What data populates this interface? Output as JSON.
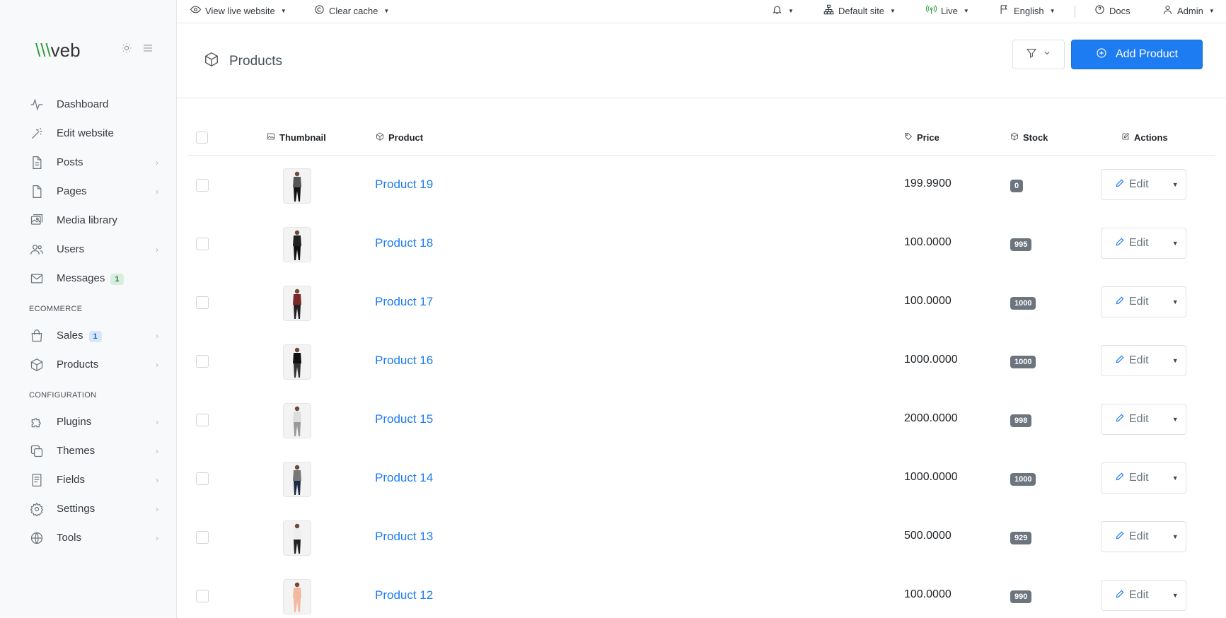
{
  "sidebar": {
    "logo": {
      "part1": "\\\\\\",
      "part2": "veb",
      "text": "\\\\\\veb"
    },
    "items": [
      {
        "label": "Dashboard",
        "icon": "activity-icon"
      },
      {
        "label": "Edit website",
        "icon": "magic-wand-icon"
      },
      {
        "label": "Posts",
        "icon": "document-icon"
      },
      {
        "label": "Pages",
        "icon": "page-icon"
      },
      {
        "label": "Media library",
        "icon": "images-icon"
      },
      {
        "label": "Users",
        "icon": "users-icon"
      },
      {
        "label": "Messages",
        "icon": "mail-icon",
        "badge": "1"
      }
    ],
    "section_ecommerce": "ECOMMERCE",
    "ecommerce_items": [
      {
        "label": "Sales",
        "icon": "shopping-bag-icon",
        "badge": "1"
      },
      {
        "label": "Products",
        "icon": "box-icon"
      }
    ],
    "section_configuration": "CONFIGURATION",
    "config_items": [
      {
        "label": "Plugins",
        "icon": "puzzle-icon"
      },
      {
        "label": "Themes",
        "icon": "copy-icon"
      },
      {
        "label": "Fields",
        "icon": "form-icon"
      },
      {
        "label": "Settings",
        "icon": "gear-icon"
      },
      {
        "label": "Tools",
        "icon": "globe-icon"
      }
    ]
  },
  "topbar": {
    "view_live": "View live website",
    "clear_cache": "Clear cache",
    "site": "Default site",
    "live": "Live",
    "language": "English",
    "docs": "Docs",
    "user": "Admin"
  },
  "header": {
    "title": "Products",
    "add_button": "Add Product"
  },
  "table": {
    "columns": {
      "thumbnail": "Thumbnail",
      "product": "Product",
      "price": "Price",
      "stock": "Stock",
      "actions": "Actions"
    },
    "edit_label": "Edit",
    "rows": [
      {
        "name": "Product 19",
        "price": "199.9900",
        "stock": "0"
      },
      {
        "name": "Product 18",
        "price": "100.0000",
        "stock": "995"
      },
      {
        "name": "Product 17",
        "price": "100.0000",
        "stock": "1000"
      },
      {
        "name": "Product 16",
        "price": "1000.0000",
        "stock": "1000"
      },
      {
        "name": "Product 15",
        "price": "2000.0000",
        "stock": "998"
      },
      {
        "name": "Product 14",
        "price": "1000.0000",
        "stock": "1000"
      },
      {
        "name": "Product 13",
        "price": "500.0000",
        "stock": "929"
      },
      {
        "name": "Product 12",
        "price": "100.0000",
        "stock": "990"
      }
    ]
  },
  "colors": {
    "accent": "#1d7cf2",
    "logo_green": "#2e9e3c",
    "live_green": "#2e9e3c",
    "stock_badge": "#6c757d"
  }
}
